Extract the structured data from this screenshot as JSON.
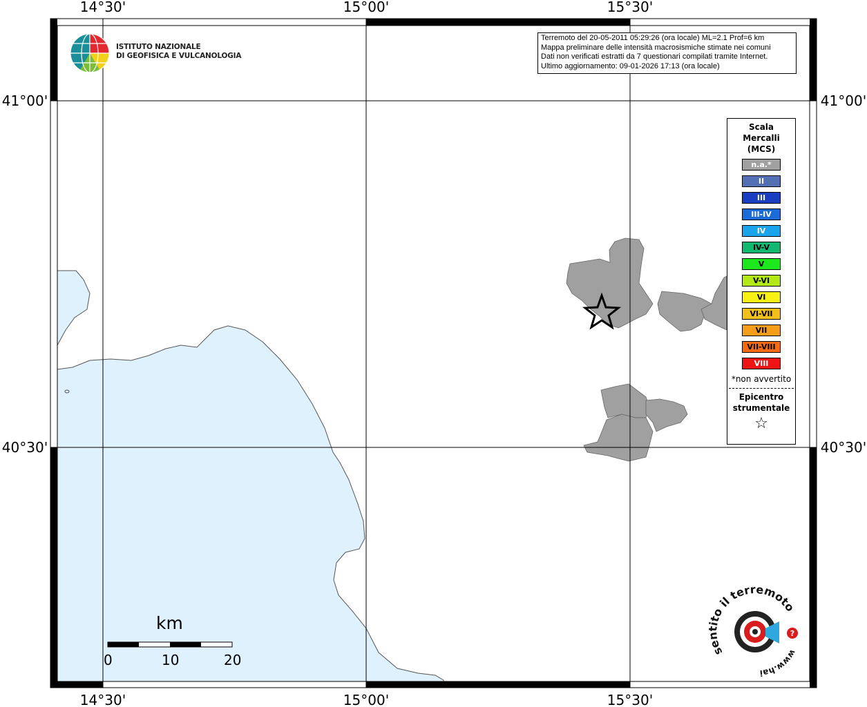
{
  "map": {
    "lon_labels": [
      "14°30'",
      "15°00'",
      "15°30'"
    ],
    "lat_labels": [
      "41°00'",
      "40°30'"
    ]
  },
  "info": {
    "line1": "Terremoto del 20-05-2011 05:29:26 (ora locale) ML=2.1 Prof=6 km",
    "line2": "Mappa preliminare delle intensità macrosismiche stimate nei comuni",
    "line3": "Dati non verificati estratti da 7 questionari compilati tramite Internet.",
    "line4": "Ultimo aggiornamento: 09-01-2026 17:13 (ora locale)"
  },
  "logo": {
    "line1": "ISTITUTO NAZIONALE",
    "line2": "DI GEOFISICA E VULCANOLOGIA"
  },
  "legend": {
    "title_1": "Scala",
    "title_2": "Mercalli",
    "title_3": "(MCS)",
    "items": [
      {
        "label": "n.a.*",
        "color": "#a0a0a0"
      },
      {
        "label": "II",
        "color": "#5470b4"
      },
      {
        "label": "III",
        "color": "#1a3ec0"
      },
      {
        "label": "III-IV",
        "color": "#1a6ad8"
      },
      {
        "label": "IV",
        "color": "#1aa4ec"
      },
      {
        "label": "IV-V",
        "color": "#12b870"
      },
      {
        "label": "V",
        "color": "#1de81d"
      },
      {
        "label": "V-VI",
        "color": "#b2e814"
      },
      {
        "label": "VI",
        "color": "#f7f214"
      },
      {
        "label": "VI-VII",
        "color": "#f3c01a"
      },
      {
        "label": "VII",
        "color": "#f69e1a"
      },
      {
        "label": "VII-VIII",
        "color": "#f46b14"
      },
      {
        "label": "VIII",
        "color": "#ee1414"
      }
    ],
    "note": "*non avvertito",
    "epicenter_1": "Epicentro",
    "epicenter_2": "strumentale"
  },
  "scale_bar": {
    "unit": "km",
    "ticks": [
      "0",
      "10",
      "20"
    ]
  },
  "watermark": {
    "text_top": "sentito il terremoto.it",
    "text_bottom": "www.hai"
  },
  "colors": {
    "sea": "#dff1fd",
    "municipality": "#a0a0a0",
    "coast": "#555555"
  }
}
